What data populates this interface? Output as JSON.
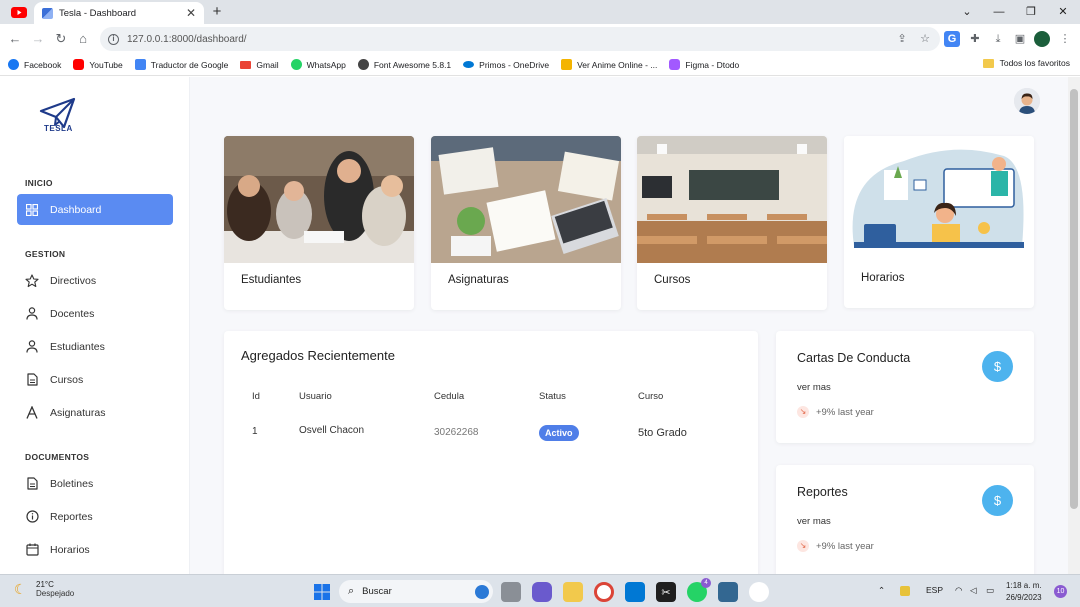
{
  "browser": {
    "tab_title": "Tesla - Dashboard",
    "url": "127.0.0.1:8000/dashboard/",
    "bookmarks": [
      {
        "label": "Facebook",
        "color": "#1877f2"
      },
      {
        "label": "YouTube",
        "color": "#ff0000"
      },
      {
        "label": "Traductor de Google",
        "color": "#4285f4"
      },
      {
        "label": "Gmail",
        "color": "#ea4335"
      },
      {
        "label": "WhatsApp",
        "color": "#25d366"
      },
      {
        "label": "Font Awesome 5.8.1",
        "color": "#333333"
      },
      {
        "label": "Primos - OneDrive",
        "color": "#0078d4"
      },
      {
        "label": "Ver Anime Online - ...",
        "color": "#f4b400"
      },
      {
        "label": "Figma - Dtodo",
        "color": "#a259ff"
      }
    ],
    "all_bookmarks": "Todos los favoritos"
  },
  "sidebar": {
    "logo_text": "TESLA",
    "sections": [
      {
        "title": "INICIO",
        "items": [
          {
            "label": "Dashboard",
            "icon": "grid-icon",
            "active": true
          }
        ]
      },
      {
        "title": "GESTION",
        "items": [
          {
            "label": "Directivos",
            "icon": "star-icon"
          },
          {
            "label": "Docentes",
            "icon": "person-icon"
          },
          {
            "label": "Estudiantes",
            "icon": "person-icon"
          },
          {
            "label": "Cursos",
            "icon": "document-icon"
          },
          {
            "label": "Asignaturas",
            "icon": "letter-a-icon"
          }
        ]
      },
      {
        "title": "DOCUMENTOS",
        "items": [
          {
            "label": "Boletines",
            "icon": "document-icon"
          },
          {
            "label": "Reportes",
            "icon": "info-circle-icon"
          },
          {
            "label": "Horarios",
            "icon": "calendar-icon"
          }
        ]
      }
    ]
  },
  "cards": [
    {
      "label": "Estudiantes"
    },
    {
      "label": "Asignaturas"
    },
    {
      "label": "Cursos"
    },
    {
      "label": "Horarios"
    }
  ],
  "recent": {
    "title": "Agregados Recientemente",
    "columns": [
      "Id",
      "Usuario",
      "Cedula",
      "Status",
      "Curso"
    ],
    "rows": [
      {
        "id": "1",
        "usuario": "Osvell Chacon",
        "cedula": "30262268",
        "status": "Activo",
        "curso": "5to Grado"
      }
    ]
  },
  "stats": [
    {
      "title": "Cartas De Conducta",
      "link": "ver mas",
      "trend": "+9% last year",
      "coin": "$"
    },
    {
      "title": "Reportes",
      "link": "ver mas",
      "trend": "+9% last year",
      "coin": "$"
    }
  ],
  "taskbar": {
    "temp": "21°C",
    "weather": "Despejado",
    "search": "Buscar",
    "lang": "ESP",
    "time": "1:18 a. m.",
    "date": "26/9/2023",
    "notif_count": "10",
    "whatsapp_badge": "4"
  },
  "colors": {
    "accent": "#5a8bf2",
    "badge": "#4f7ee8",
    "coin": "#4db3ee"
  }
}
